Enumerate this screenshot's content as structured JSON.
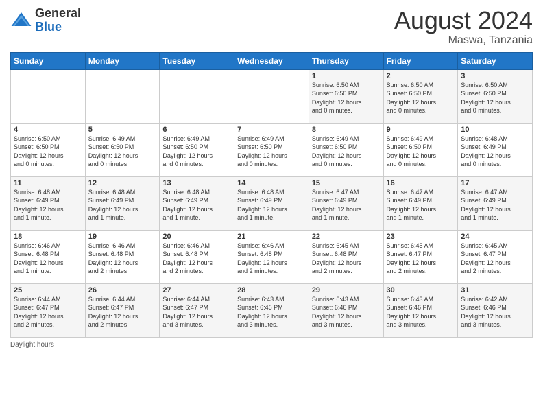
{
  "header": {
    "logo_general": "General",
    "logo_blue": "Blue",
    "month_title": "August 2024",
    "subtitle": "Maswa, Tanzania"
  },
  "footer": {
    "daylight_label": "Daylight hours"
  },
  "days_of_week": [
    "Sunday",
    "Monday",
    "Tuesday",
    "Wednesday",
    "Thursday",
    "Friday",
    "Saturday"
  ],
  "weeks": [
    [
      {
        "day": "",
        "info": ""
      },
      {
        "day": "",
        "info": ""
      },
      {
        "day": "",
        "info": ""
      },
      {
        "day": "",
        "info": ""
      },
      {
        "day": "1",
        "info": "Sunrise: 6:50 AM\nSunset: 6:50 PM\nDaylight: 12 hours\nand 0 minutes."
      },
      {
        "day": "2",
        "info": "Sunrise: 6:50 AM\nSunset: 6:50 PM\nDaylight: 12 hours\nand 0 minutes."
      },
      {
        "day": "3",
        "info": "Sunrise: 6:50 AM\nSunset: 6:50 PM\nDaylight: 12 hours\nand 0 minutes."
      }
    ],
    [
      {
        "day": "4",
        "info": "Sunrise: 6:50 AM\nSunset: 6:50 PM\nDaylight: 12 hours\nand 0 minutes."
      },
      {
        "day": "5",
        "info": "Sunrise: 6:49 AM\nSunset: 6:50 PM\nDaylight: 12 hours\nand 0 minutes."
      },
      {
        "day": "6",
        "info": "Sunrise: 6:49 AM\nSunset: 6:50 PM\nDaylight: 12 hours\nand 0 minutes."
      },
      {
        "day": "7",
        "info": "Sunrise: 6:49 AM\nSunset: 6:50 PM\nDaylight: 12 hours\nand 0 minutes."
      },
      {
        "day": "8",
        "info": "Sunrise: 6:49 AM\nSunset: 6:50 PM\nDaylight: 12 hours\nand 0 minutes."
      },
      {
        "day": "9",
        "info": "Sunrise: 6:49 AM\nSunset: 6:50 PM\nDaylight: 12 hours\nand 0 minutes."
      },
      {
        "day": "10",
        "info": "Sunrise: 6:48 AM\nSunset: 6:49 PM\nDaylight: 12 hours\nand 0 minutes."
      }
    ],
    [
      {
        "day": "11",
        "info": "Sunrise: 6:48 AM\nSunset: 6:49 PM\nDaylight: 12 hours\nand 1 minute."
      },
      {
        "day": "12",
        "info": "Sunrise: 6:48 AM\nSunset: 6:49 PM\nDaylight: 12 hours\nand 1 minute."
      },
      {
        "day": "13",
        "info": "Sunrise: 6:48 AM\nSunset: 6:49 PM\nDaylight: 12 hours\nand 1 minute."
      },
      {
        "day": "14",
        "info": "Sunrise: 6:48 AM\nSunset: 6:49 PM\nDaylight: 12 hours\nand 1 minute."
      },
      {
        "day": "15",
        "info": "Sunrise: 6:47 AM\nSunset: 6:49 PM\nDaylight: 12 hours\nand 1 minute."
      },
      {
        "day": "16",
        "info": "Sunrise: 6:47 AM\nSunset: 6:49 PM\nDaylight: 12 hours\nand 1 minute."
      },
      {
        "day": "17",
        "info": "Sunrise: 6:47 AM\nSunset: 6:49 PM\nDaylight: 12 hours\nand 1 minute."
      }
    ],
    [
      {
        "day": "18",
        "info": "Sunrise: 6:46 AM\nSunset: 6:48 PM\nDaylight: 12 hours\nand 1 minute."
      },
      {
        "day": "19",
        "info": "Sunrise: 6:46 AM\nSunset: 6:48 PM\nDaylight: 12 hours\nand 2 minutes."
      },
      {
        "day": "20",
        "info": "Sunrise: 6:46 AM\nSunset: 6:48 PM\nDaylight: 12 hours\nand 2 minutes."
      },
      {
        "day": "21",
        "info": "Sunrise: 6:46 AM\nSunset: 6:48 PM\nDaylight: 12 hours\nand 2 minutes."
      },
      {
        "day": "22",
        "info": "Sunrise: 6:45 AM\nSunset: 6:48 PM\nDaylight: 12 hours\nand 2 minutes."
      },
      {
        "day": "23",
        "info": "Sunrise: 6:45 AM\nSunset: 6:47 PM\nDaylight: 12 hours\nand 2 minutes."
      },
      {
        "day": "24",
        "info": "Sunrise: 6:45 AM\nSunset: 6:47 PM\nDaylight: 12 hours\nand 2 minutes."
      }
    ],
    [
      {
        "day": "25",
        "info": "Sunrise: 6:44 AM\nSunset: 6:47 PM\nDaylight: 12 hours\nand 2 minutes."
      },
      {
        "day": "26",
        "info": "Sunrise: 6:44 AM\nSunset: 6:47 PM\nDaylight: 12 hours\nand 2 minutes."
      },
      {
        "day": "27",
        "info": "Sunrise: 6:44 AM\nSunset: 6:47 PM\nDaylight: 12 hours\nand 3 minutes."
      },
      {
        "day": "28",
        "info": "Sunrise: 6:43 AM\nSunset: 6:46 PM\nDaylight: 12 hours\nand 3 minutes."
      },
      {
        "day": "29",
        "info": "Sunrise: 6:43 AM\nSunset: 6:46 PM\nDaylight: 12 hours\nand 3 minutes."
      },
      {
        "day": "30",
        "info": "Sunrise: 6:43 AM\nSunset: 6:46 PM\nDaylight: 12 hours\nand 3 minutes."
      },
      {
        "day": "31",
        "info": "Sunrise: 6:42 AM\nSunset: 6:46 PM\nDaylight: 12 hours\nand 3 minutes."
      }
    ]
  ]
}
